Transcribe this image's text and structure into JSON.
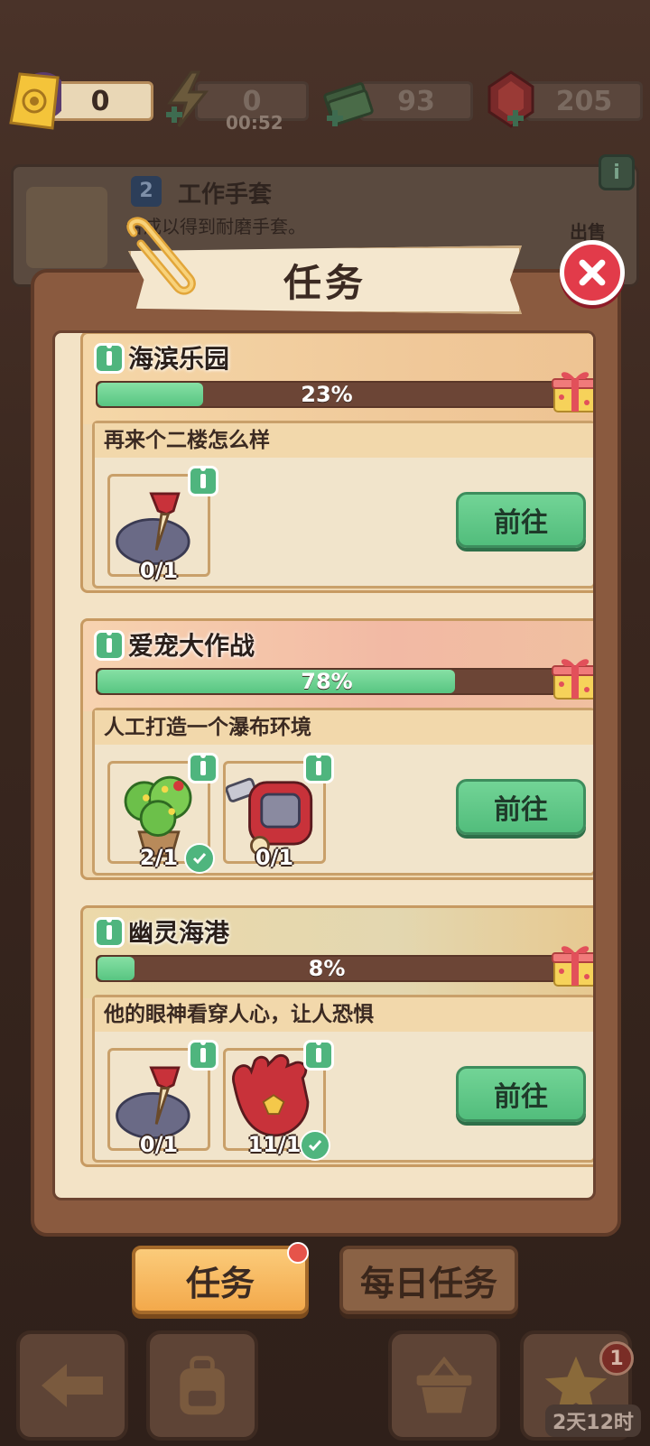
{
  "resources": {
    "tickets": "0",
    "energy": "0",
    "energy_timer": "00:52",
    "cash": "93",
    "gems": "205"
  },
  "behind_card": {
    "level": "2",
    "title": "工作手套",
    "desc": "合成以得到耐磨手套。",
    "sell": "出售"
  },
  "dialog": {
    "title": "任务"
  },
  "tasks": [
    {
      "title": "海滨乐园",
      "progress": 23,
      "progress_label": "23%",
      "subtitle": "再来个二楼怎么样",
      "items": [
        {
          "name": "trowel-icon",
          "count": "0/1",
          "done": false
        }
      ],
      "button": "前往"
    },
    {
      "title": "爱宠大作战",
      "progress": 78,
      "progress_label": "78%",
      "subtitle": "人工打造一个瀑布环境",
      "items": [
        {
          "name": "potted-tree-icon",
          "count": "2/1",
          "done": true
        },
        {
          "name": "red-device-icon",
          "count": "0/1",
          "done": false
        }
      ],
      "button": "前往"
    },
    {
      "title": "幽灵海港",
      "progress": 8,
      "progress_label": "8%",
      "subtitle": "他的眼神看穿人心，让人恐惧",
      "items": [
        {
          "name": "trowel-icon",
          "count": "0/1",
          "done": false
        },
        {
          "name": "red-glove-icon",
          "count": "11/1",
          "done": true
        }
      ],
      "button": "前往"
    }
  ],
  "tabs": {
    "active": "任务",
    "inactive": "每日任务"
  },
  "nav": {
    "badge": "1",
    "countdown": "2天12时"
  },
  "colors": {
    "accent_green": "#52bd7c",
    "panel_brown": "#8a5a3f",
    "close_red": "#e23b4a",
    "tab_orange": "#f3a94b"
  }
}
